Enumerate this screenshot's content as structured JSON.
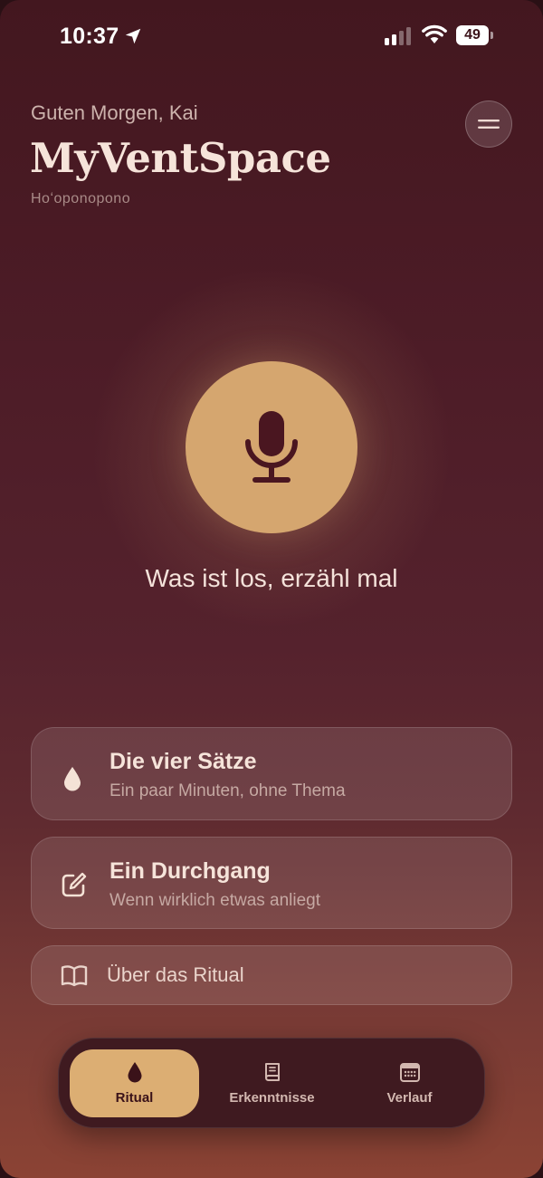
{
  "status_bar": {
    "time": "10:37",
    "battery": "49",
    "icons": [
      "location-arrow-icon",
      "signal-icon",
      "wifi-icon",
      "battery-icon"
    ]
  },
  "header": {
    "greeting": "Guten Morgen, Kai",
    "title": "MyVentSpace",
    "subtitle": "Hoʻoponopono",
    "menu_icon": "menu-icon"
  },
  "mic": {
    "icon": "microphone-icon",
    "prompt": "Was ist los, erzähl mal"
  },
  "cards": [
    {
      "icon": "drop-icon",
      "title": "Die vier Sätze",
      "subtitle": "Ein paar Minuten, ohne Thema"
    },
    {
      "icon": "edit-icon",
      "title": "Ein Durchgang",
      "subtitle": "Wenn wirklich etwas anliegt"
    },
    {
      "icon": "book-icon",
      "label": "Über das Ritual"
    }
  ],
  "tabbar": {
    "tabs": [
      {
        "label": "Ritual",
        "icon": "drop-icon",
        "active": true
      },
      {
        "label": "Erkenntnisse",
        "icon": "book-icon",
        "active": false
      },
      {
        "label": "Verlauf",
        "icon": "calendar-icon",
        "active": false
      }
    ]
  },
  "colors": {
    "accent": "#d5a66f",
    "background_top": "#43171f",
    "background_bottom": "#8b4334",
    "text_primary": "#f6e4da"
  }
}
